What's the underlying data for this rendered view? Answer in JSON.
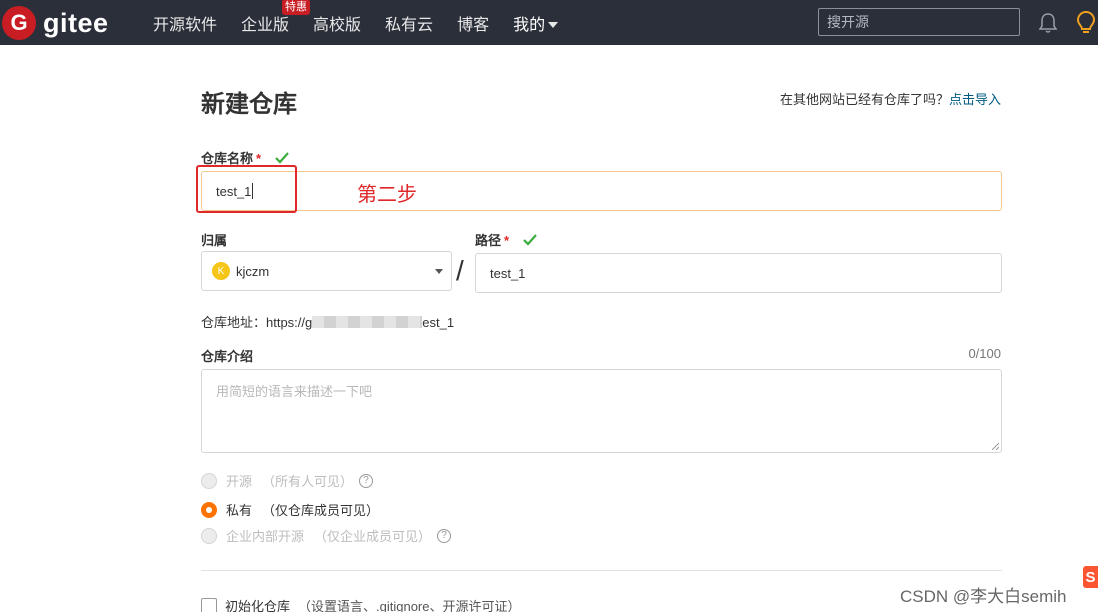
{
  "nav": {
    "logo_text": "gitee",
    "items": [
      {
        "label": "开源软件"
      },
      {
        "label": "企业版",
        "badge": "特惠"
      },
      {
        "label": "高校版"
      },
      {
        "label": "私有云"
      },
      {
        "label": "博客"
      },
      {
        "label": "我的"
      }
    ],
    "search_placeholder": "搜开源"
  },
  "page": {
    "title": "新建仓库",
    "import_hint": "在其他网站已经有仓库了吗？",
    "import_link": "点击导入"
  },
  "form": {
    "name_label": "仓库名称",
    "required_mark": "*",
    "name_value": "test_1",
    "annotation": "第二步",
    "owner_label": "归属",
    "owner_avatar": "K",
    "owner_value": "kjczm",
    "path_label": "路径",
    "path_value": "test_1",
    "slash": "/",
    "address_prefix": "仓库地址：https://g",
    "address_suffix": "est_1",
    "intro_label": "仓库介绍",
    "intro_counter": "0/100",
    "intro_placeholder": "用简短的语言来描述一下吧",
    "visibility": [
      {
        "label": "开源",
        "sub": "（所有人可见）",
        "selected": false,
        "disabled": true,
        "help": "?"
      },
      {
        "label": "私有",
        "sub": "（仅仓库成员可见）",
        "selected": true,
        "disabled": false
      },
      {
        "label": "企业内部开源",
        "sub": "（仅企业成员可见）",
        "selected": false,
        "disabled": true,
        "help": "?"
      }
    ],
    "init_label": "初始化仓库",
    "init_sub": "（设置语言、.gitignore、开源许可证）"
  },
  "watermark": "CSDN @李大白semih",
  "colors": {
    "navbar": "#2b2f3a",
    "brand": "#c71d23",
    "accent": "#fe7300",
    "success": "#3bab3b",
    "annotation": "#e0282a",
    "link": "#005980"
  }
}
